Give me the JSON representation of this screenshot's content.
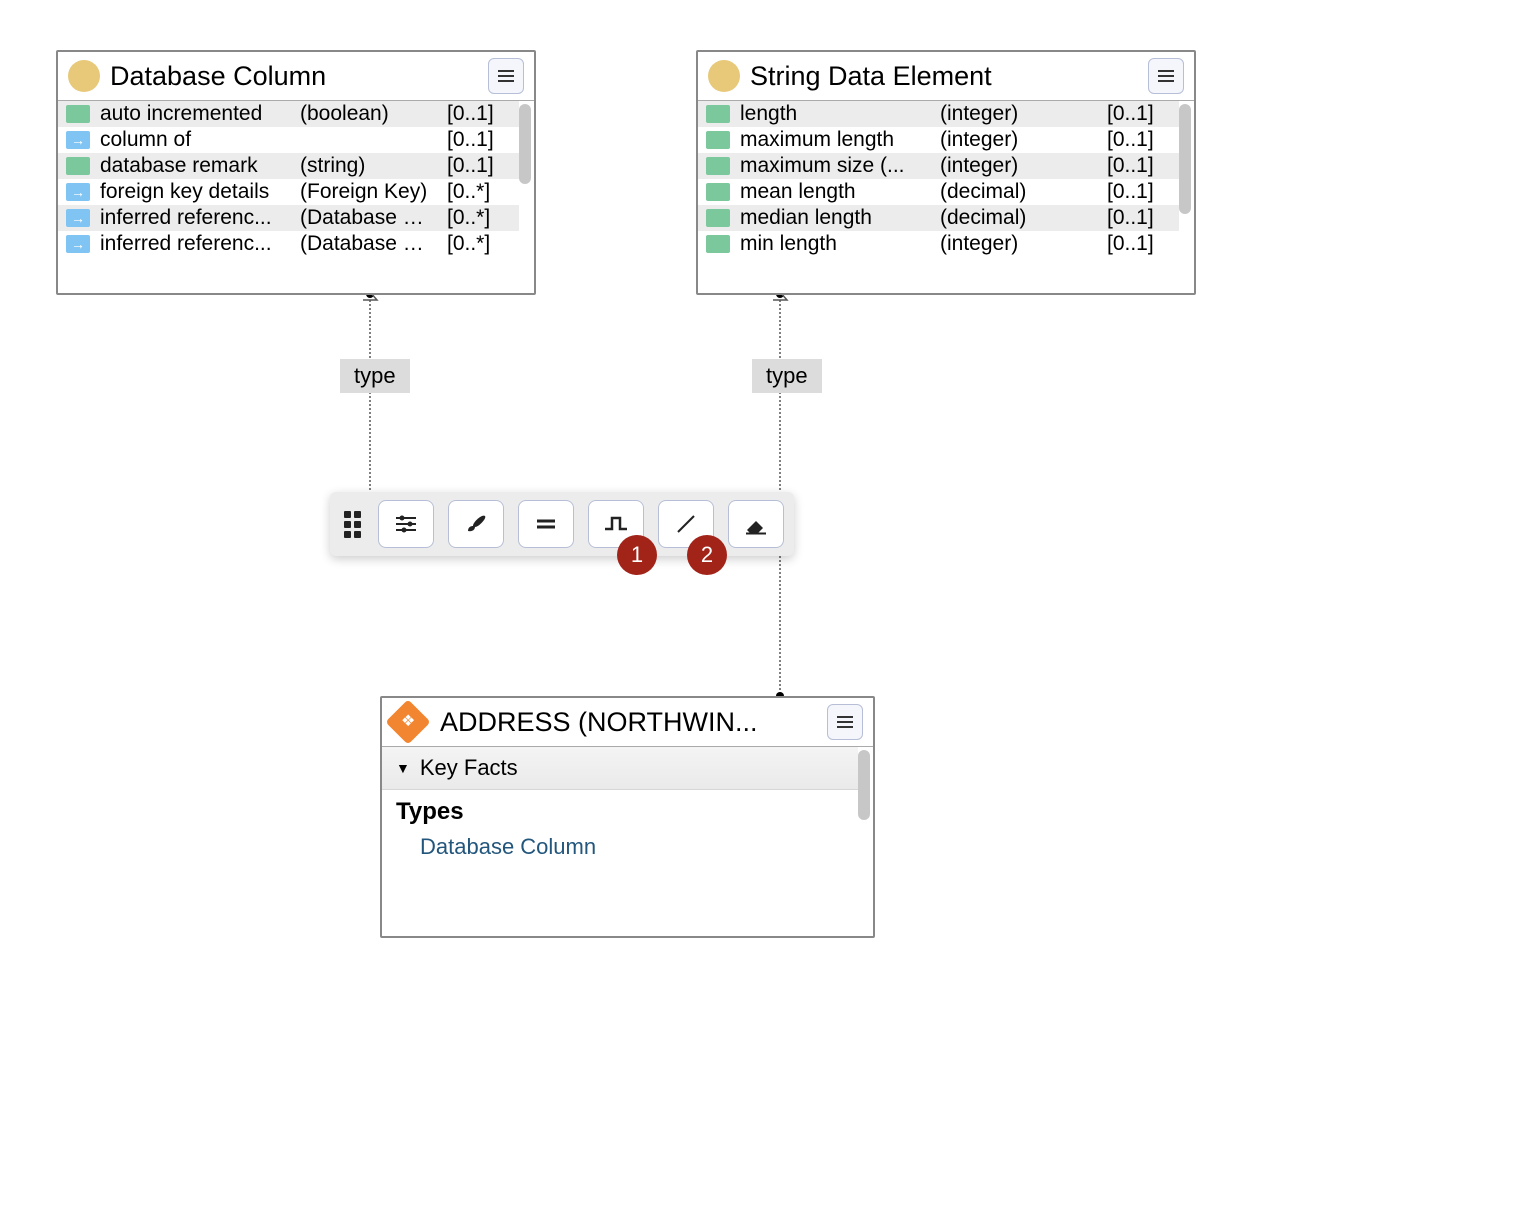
{
  "nodes": {
    "db_column": {
      "title": "Database Column",
      "rows": [
        {
          "icon": "attr",
          "name": "auto incremented",
          "type": "(boolean)",
          "card": "[0..1]"
        },
        {
          "icon": "ref",
          "name": "column of",
          "type": "",
          "card": "[0..1]"
        },
        {
          "icon": "attr",
          "name": "database remark",
          "type": "(string)",
          "card": "[0..1]"
        },
        {
          "icon": "ref",
          "name": "foreign key details",
          "type": "(Foreign Key)",
          "card": "[0..*]"
        },
        {
          "icon": "ref",
          "name": "inferred referenc...",
          "type": "(Database Colu...",
          "card": "[0..*]"
        },
        {
          "icon": "ref",
          "name": "inferred referenc...",
          "type": "(Database Colu...",
          "card": "[0..*]"
        }
      ]
    },
    "string_de": {
      "title": "String Data Element",
      "rows": [
        {
          "icon": "attr",
          "name": "length",
          "type": "(integer)",
          "card": "[0..1]"
        },
        {
          "icon": "attr",
          "name": "maximum length",
          "type": "(integer)",
          "card": "[0..1]"
        },
        {
          "icon": "attr",
          "name": "maximum size (...",
          "type": "(integer)",
          "card": "[0..1]"
        },
        {
          "icon": "attr",
          "name": "mean length",
          "type": "(decimal)",
          "card": "[0..1]"
        },
        {
          "icon": "attr",
          "name": "median length",
          "type": "(decimal)",
          "card": "[0..1]"
        },
        {
          "icon": "attr",
          "name": "min length",
          "type": "(integer)",
          "card": "[0..1]"
        }
      ]
    },
    "address": {
      "title": "ADDRESS (NORTHWIN...",
      "section": "Key Facts",
      "types_heading": "Types",
      "types_link": "Database Column"
    }
  },
  "edges": {
    "label": "type"
  },
  "toolbar": {
    "callouts": [
      "1",
      "2"
    ]
  }
}
